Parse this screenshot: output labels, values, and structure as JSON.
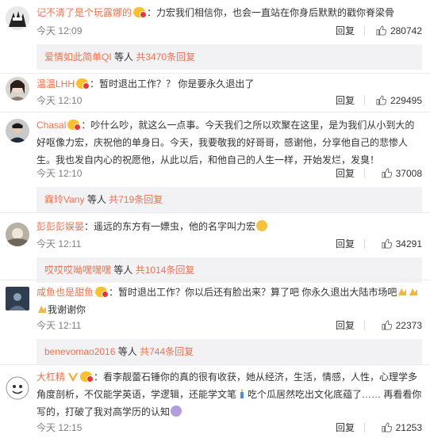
{
  "reply_label": "回复",
  "comments": [
    {
      "user": "记不清了是个玩露娜的",
      "text": "：力宏我们相信你，也会一直站在你身后默默的戳你脊梁骨",
      "time": "今天 12:09",
      "likes": "280742",
      "sub": {
        "users": "爱情如此简单QI",
        "etc": "等人",
        "more": "共3470条回复"
      }
    },
    {
      "user": "温温LHH",
      "text": "：暂时退出工作？？ 你是要永久退出了",
      "time": "今天 12:10",
      "likes": "229495"
    },
    {
      "user": "Chasal",
      "text": "：吵什么吵，就这么一点事。今天我们之所以欢聚在这里，是为我们从小到大的好呕像力宏，庆祝他的单身日。今天，我要敬我的好哥哥，感谢他，分享他自己的悲惨人生。我也发自内心的祝愿他，从此以后，和他自己的人生一样，开始发烂，发臭！",
      "time": "今天 12:10",
      "likes": "37008",
      "sub": {
        "users": "霖玲Vany",
        "etc": "等人",
        "more": "共719条回复"
      }
    },
    {
      "user": "彭彭彭娱晏",
      "text": "：遥远的东方有一嫖虫，他的名字叫力宏",
      "time": "今天 12:11",
      "likes": "34291",
      "sub": {
        "users": "哎哎哎呦嘿嘿嘿",
        "etc": "等人",
        "more": "共1014条回复"
      }
    },
    {
      "user": "咸鱼也是甜鱼",
      "text": "：暂时退出工作？你以后还有脸出来？算了吧 你永久退出大陆市场吧",
      "text_tail": "我谢谢你",
      "time": "今天 12:11",
      "likes": "22373",
      "sub": {
        "users": "benevomao2016",
        "etc": "等人",
        "more": "共744条回复"
      }
    },
    {
      "user": "大杠精",
      "text": "：看李靓蕾石锤你的真的很有收获，她从经济，生活，情感，人性，心理学多角度剖析，不仅能学英语，学逻辑，还能学文笔",
      "text_tail": "吃个瓜居然吃出文化底蕴了…… 再看看你写的，打破了我对高学历的认知",
      "time": "今天 12:15",
      "likes": "21253"
    }
  ]
}
